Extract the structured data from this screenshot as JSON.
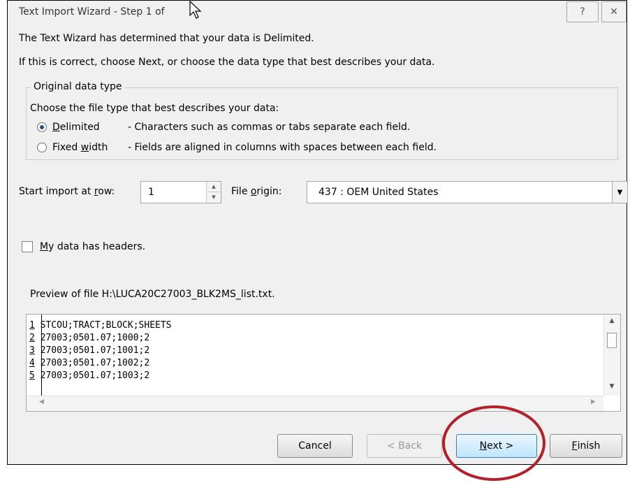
{
  "window": {
    "title": "Text Import Wizard - Step 1 of",
    "help_glyph": "?",
    "close_glyph": "✕"
  },
  "intro": {
    "line1": "The Text Wizard has determined that your data is Delimited.",
    "line2": "If this is correct, choose Next, or choose the data type that best describes your data."
  },
  "original_data_type": {
    "legend": "Original data type",
    "prompt": "Choose the file type that best describes your data:",
    "options": [
      {
        "label_pre": "",
        "label_key": "D",
        "label_post": "elimited",
        "description": "- Characters such as commas or tabs separate each field.",
        "selected": true
      },
      {
        "label_pre": "Fixed ",
        "label_key": "w",
        "label_post": "idth",
        "description": "- Fields are aligned in columns with spaces between each field.",
        "selected": false
      }
    ]
  },
  "start_row": {
    "label_pre": "Start import at ",
    "label_key": "r",
    "label_post": "ow:",
    "value": "1"
  },
  "file_origin": {
    "label_pre": "File ",
    "label_key": "o",
    "label_post": "rigin:",
    "value": "437 : OEM United States"
  },
  "headers_checkbox": {
    "label_key": "M",
    "label_post": "y data has headers.",
    "checked": false
  },
  "preview": {
    "caption": "Preview of file H:\\LUCA20C27003_BLK2MS_list.txt.",
    "rows": [
      {
        "num": "1",
        "text": "STCOU;TRACT;BLOCK;SHEETS"
      },
      {
        "num": "2",
        "text": "27003;0501.07;1000;2"
      },
      {
        "num": "3",
        "text": "27003;0501.07;1001;2"
      },
      {
        "num": "4",
        "text": "27003;0501.07;1002;2"
      },
      {
        "num": "5",
        "text": "27003;0501.07;1003;2"
      }
    ]
  },
  "buttons": {
    "cancel": "Cancel",
    "back": "< Back",
    "next_key": "N",
    "next_post": "ext >",
    "finish_key": "F",
    "finish_post": "inish"
  },
  "annotation_color": "#b3202a"
}
